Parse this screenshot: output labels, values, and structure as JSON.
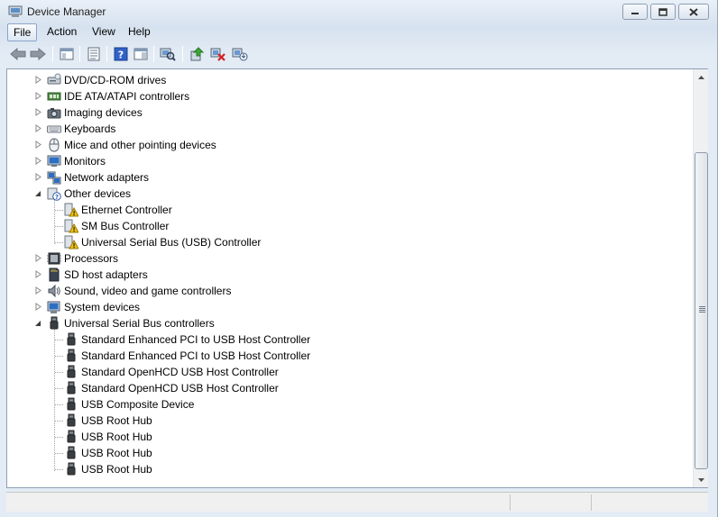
{
  "window": {
    "title": "Device Manager"
  },
  "menu": [
    {
      "label": "File",
      "active": true
    },
    {
      "label": "Action",
      "active": false
    },
    {
      "label": "View",
      "active": false
    },
    {
      "label": "Help",
      "active": false
    }
  ],
  "toolbar": [
    {
      "icon": "back-arrow-icon"
    },
    {
      "icon": "forward-arrow-icon"
    },
    {
      "icon": "show-hide-console-tree-icon"
    },
    {
      "icon": "properties-icon"
    },
    {
      "icon": "help-icon"
    },
    {
      "icon": "action-pane-icon"
    },
    {
      "icon": "scan-hardware-changes-icon"
    },
    {
      "icon": "update-driver-icon"
    },
    {
      "icon": "disable-device-icon"
    },
    {
      "icon": "uninstall-device-icon"
    }
  ],
  "tree": [
    {
      "label": "DVD/CD-ROM drives",
      "level": 0,
      "expander": "collapsed",
      "icon": "dvd-drive-icon"
    },
    {
      "label": "IDE ATA/ATAPI controllers",
      "level": 0,
      "expander": "collapsed",
      "icon": "ide-controller-icon"
    },
    {
      "label": "Imaging devices",
      "level": 0,
      "expander": "collapsed",
      "icon": "camera-icon"
    },
    {
      "label": "Keyboards",
      "level": 0,
      "expander": "collapsed",
      "icon": "keyboard-icon"
    },
    {
      "label": "Mice and other pointing devices",
      "level": 0,
      "expander": "collapsed",
      "icon": "mouse-icon"
    },
    {
      "label": "Monitors",
      "level": 0,
      "expander": "collapsed",
      "icon": "monitor-icon"
    },
    {
      "label": "Network adapters",
      "level": 0,
      "expander": "collapsed",
      "icon": "network-adapter-icon"
    },
    {
      "label": "Other devices",
      "level": 0,
      "expander": "expanded",
      "icon": "unknown-device-icon"
    },
    {
      "label": "Ethernet Controller",
      "level": 1,
      "icon": "warning-device-icon"
    },
    {
      "label": "SM Bus Controller",
      "level": 1,
      "icon": "warning-device-icon"
    },
    {
      "label": "Universal Serial Bus (USB) Controller",
      "level": 1,
      "icon": "warning-device-icon"
    },
    {
      "label": "Processors",
      "level": 0,
      "expander": "collapsed",
      "icon": "processor-icon"
    },
    {
      "label": "SD host adapters",
      "level": 0,
      "expander": "collapsed",
      "icon": "sd-card-icon"
    },
    {
      "label": "Sound, video and game controllers",
      "level": 0,
      "expander": "collapsed",
      "icon": "speaker-icon"
    },
    {
      "label": "System devices",
      "level": 0,
      "expander": "collapsed",
      "icon": "system-devices-icon"
    },
    {
      "label": "Universal Serial Bus controllers",
      "level": 0,
      "expander": "expanded",
      "icon": "usb-plug-icon"
    },
    {
      "label": "Standard Enhanced PCI to USB Host Controller",
      "level": 1,
      "icon": "usb-plug-icon"
    },
    {
      "label": "Standard Enhanced PCI to USB Host Controller",
      "level": 1,
      "icon": "usb-plug-icon"
    },
    {
      "label": "Standard OpenHCD USB Host Controller",
      "level": 1,
      "icon": "usb-plug-icon"
    },
    {
      "label": "Standard OpenHCD USB Host Controller",
      "level": 1,
      "icon": "usb-plug-icon"
    },
    {
      "label": "USB Composite Device",
      "level": 1,
      "icon": "usb-plug-icon"
    },
    {
      "label": "USB Root Hub",
      "level": 1,
      "icon": "usb-plug-icon"
    },
    {
      "label": "USB Root Hub",
      "level": 1,
      "icon": "usb-plug-icon"
    },
    {
      "label": "USB Root Hub",
      "level": 1,
      "icon": "usb-plug-icon"
    },
    {
      "label": "USB Root Hub",
      "level": 1,
      "icon": "usb-plug-icon"
    }
  ],
  "colors": {
    "warning": "#f2c200",
    "selection_border": "#8aa5c8",
    "pane_border": "#8e9fb3"
  }
}
